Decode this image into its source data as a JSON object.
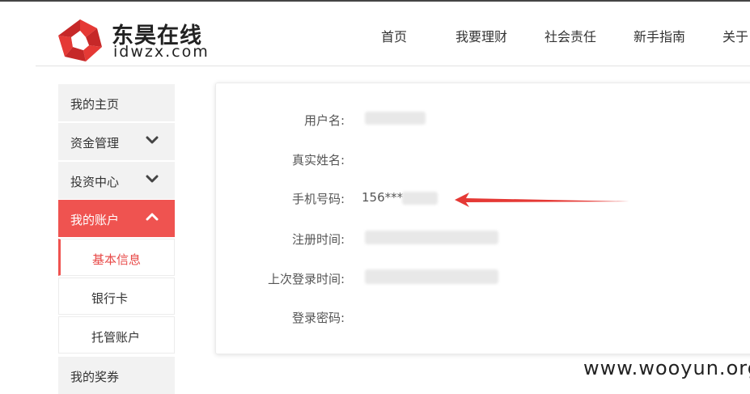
{
  "logo": {
    "cn": "东昊在线",
    "en": "idwzx.com"
  },
  "nav": [
    "首页",
    "我要理财",
    "社会责任",
    "新手指南",
    "关于"
  ],
  "sidebar": {
    "items": [
      {
        "label": "我的主页"
      },
      {
        "label": "资金管理"
      },
      {
        "label": "投资中心"
      },
      {
        "label": "我的账户"
      }
    ],
    "subitems": [
      {
        "label": "基本信息"
      },
      {
        "label": "银行卡"
      },
      {
        "label": "托管账户"
      }
    ],
    "bottom_item": {
      "label": "我的奖券"
    },
    "active_color": "#ef5350"
  },
  "profile": {
    "rows": [
      {
        "label": "用户名:",
        "value": ""
      },
      {
        "label": "真实姓名:",
        "value": ""
      },
      {
        "label": "手机号码:",
        "value": "156***"
      },
      {
        "label": "注册时间:",
        "value": ""
      },
      {
        "label": "上次登录时间:",
        "value": ""
      },
      {
        "label": "登录密码:",
        "value": ""
      }
    ]
  },
  "annotation": {
    "arrow_color": "#e53935"
  },
  "watermark": "www.wooyun.org"
}
